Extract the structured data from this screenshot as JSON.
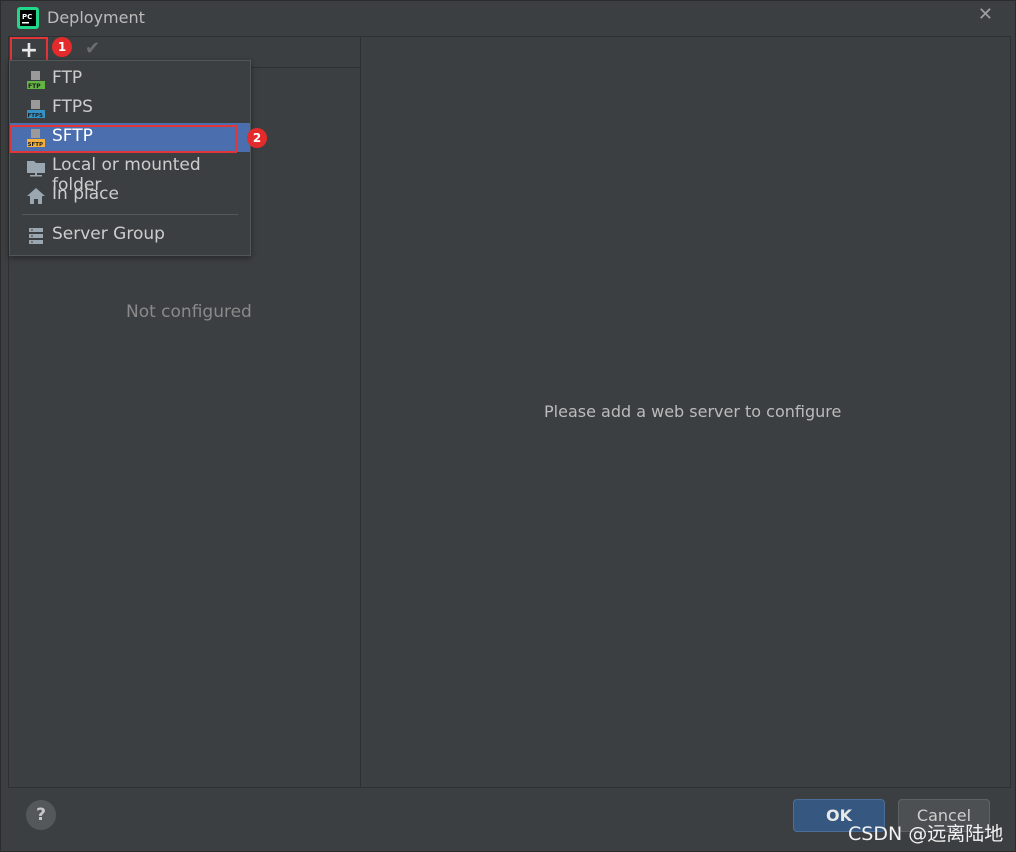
{
  "window": {
    "title": "Deployment"
  },
  "toolbar": {
    "add_label": "+",
    "badge1": "1"
  },
  "left": {
    "empty_text": "Not configured"
  },
  "right": {
    "placeholder": "Please add a web server to configure"
  },
  "menu": {
    "items": [
      {
        "label": "FTP",
        "icon": "ftp-icon",
        "tag": "FTP"
      },
      {
        "label": "FTPS",
        "icon": "ftps-icon",
        "tag": "FTPS"
      },
      {
        "label": "SFTP",
        "icon": "sftp-icon",
        "tag": "SFTP"
      },
      {
        "label": "Local or mounted folder",
        "icon": "folder-icon"
      },
      {
        "label": "In place",
        "icon": "home-icon"
      },
      {
        "label": "Server Group",
        "icon": "server-group-icon"
      }
    ],
    "badge2": "2"
  },
  "buttons": {
    "help": "?",
    "ok": "OK",
    "cancel": "Cancel"
  },
  "watermark": "CSDN @远离陆地",
  "colors": {
    "selection": "#4b6eaf",
    "highlight": "#e0363a",
    "ok": "#365880"
  }
}
